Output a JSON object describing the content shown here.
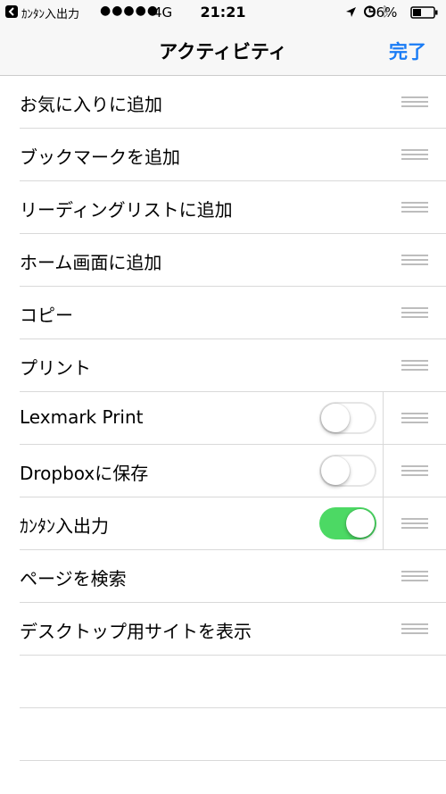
{
  "status_bar": {
    "back_app": "ｶﾝﾀﾝ入出力",
    "signal": "●●●●●",
    "network": "4G",
    "time": "21:21",
    "battery": "36%"
  },
  "nav": {
    "title": "アクティビティ",
    "done": "完了"
  },
  "rows": [
    {
      "label": "お気に入りに追加"
    },
    {
      "label": "ブックマークを追加"
    },
    {
      "label": "リーディングリストに追加"
    },
    {
      "label": "ホーム画面に追加"
    },
    {
      "label": "コピー"
    },
    {
      "label": "プリント"
    },
    {
      "label": "Lexmark Print",
      "toggle": "off"
    },
    {
      "label": "Dropboxに保存",
      "toggle": "off"
    },
    {
      "label": "ｶﾝﾀﾝ入出力",
      "toggle": "on"
    },
    {
      "label": "ページを検索"
    },
    {
      "label": "デスクトップ用サイトを表示"
    }
  ],
  "colors": {
    "accent": "#1a7cf5",
    "toggle_on": "#4cd964"
  }
}
